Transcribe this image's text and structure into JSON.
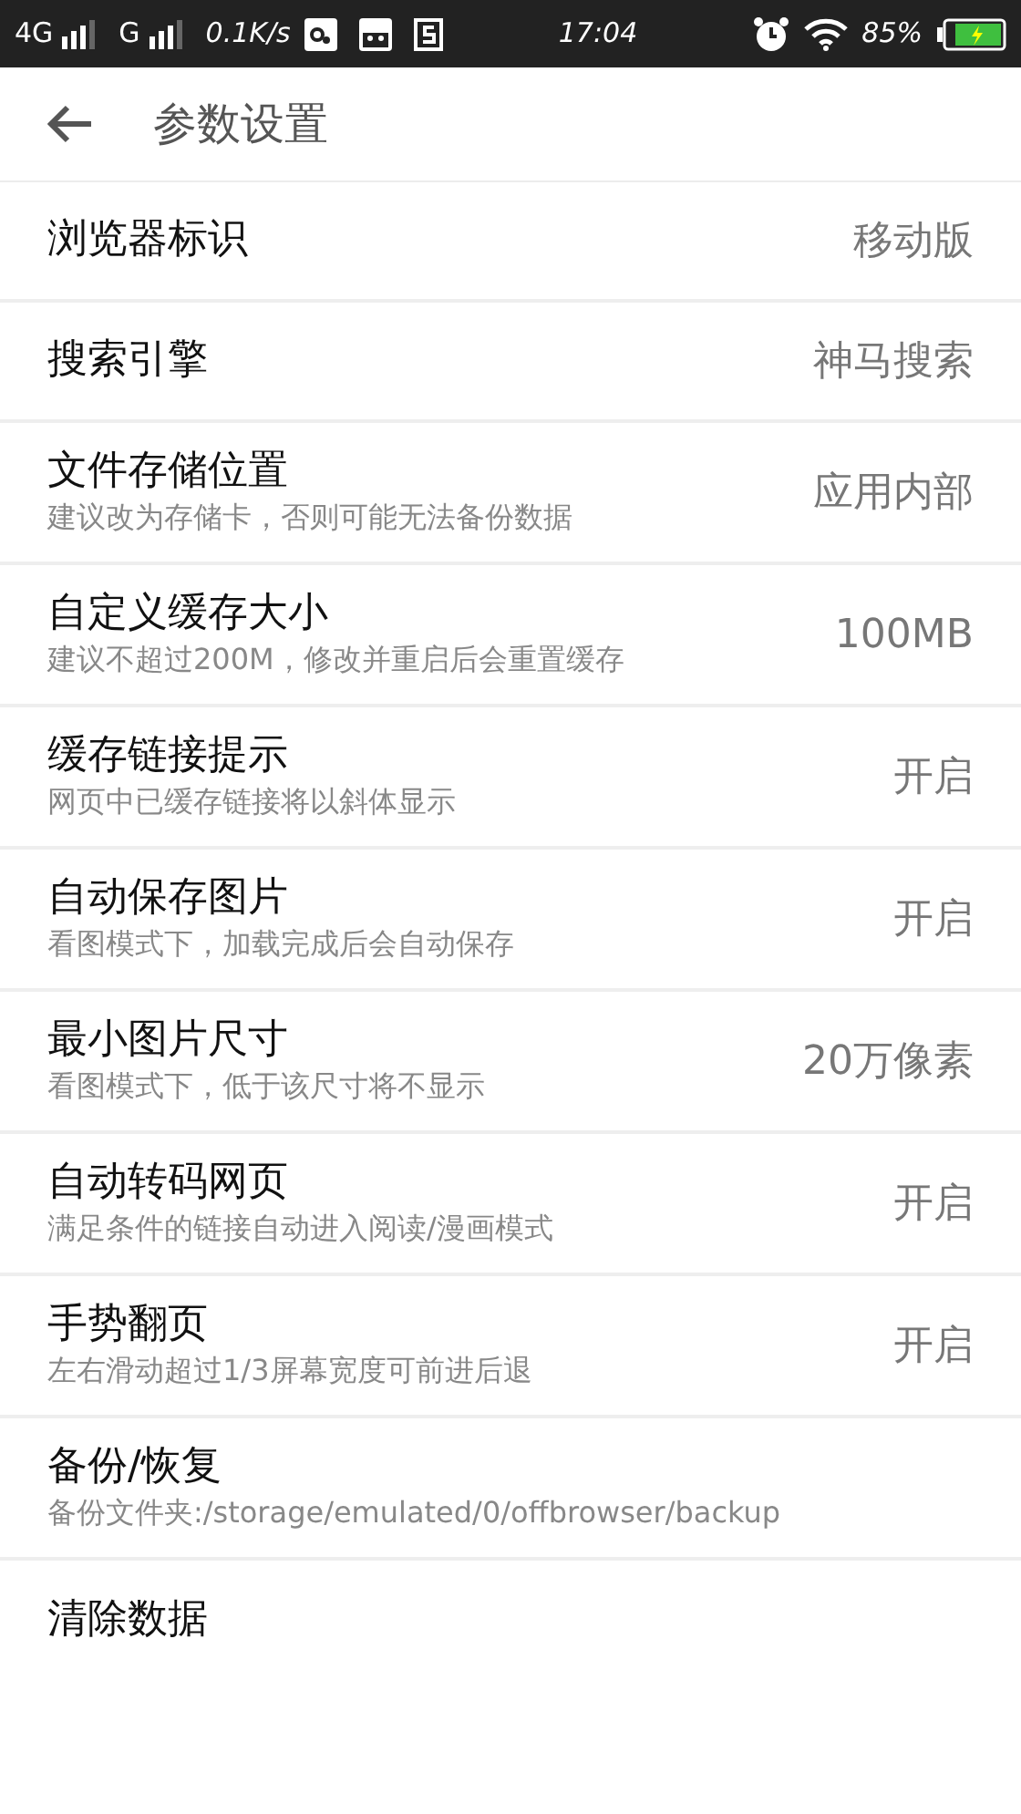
{
  "status_bar": {
    "network_1": "4G",
    "network_2": "G",
    "speed": "0.1K/s",
    "time": "17:04",
    "battery": "85%"
  },
  "header": {
    "title": "参数设置"
  },
  "settings": [
    {
      "title": "浏览器标识",
      "value": "移动版"
    },
    {
      "title": "搜索引擎",
      "value": "神马搜索"
    },
    {
      "title": "文件存储位置",
      "subtitle": "建议改为存储卡，否则可能无法备份数据",
      "value": "应用内部"
    },
    {
      "title": "自定义缓存大小",
      "subtitle": "建议不超过200M，修改并重启后会重置缓存",
      "value": "100MB"
    },
    {
      "title": "缓存链接提示",
      "subtitle": "网页中已缓存链接将以斜体显示",
      "value": "开启"
    },
    {
      "title": "自动保存图片",
      "subtitle": "看图模式下，加载完成后会自动保存",
      "value": "开启"
    },
    {
      "title": "最小图片尺寸",
      "subtitle": "看图模式下，低于该尺寸将不显示",
      "value": "20万像素"
    },
    {
      "title": "自动转码网页",
      "subtitle": "满足条件的链接自动进入阅读/漫画模式",
      "value": "开启"
    },
    {
      "title": "手势翻页",
      "subtitle": "左右滑动超过1/3屏幕宽度可前进后退",
      "value": "开启"
    },
    {
      "title": "备份/恢复",
      "subtitle": "备份文件夹:/storage/emulated/0/offbrowser/backup"
    },
    {
      "title": "清除数据"
    }
  ]
}
